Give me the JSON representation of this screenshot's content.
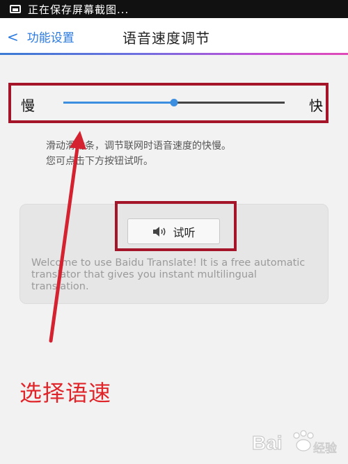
{
  "status_bar": {
    "text": "正在保存屏幕截图...",
    "icon": "screenshot-icon"
  },
  "header": {
    "back_label": "功能设置",
    "back_icon": "chevron-left-icon",
    "title": "语音速度调节",
    "gradient_colors": [
      "#3a7bd5",
      "#c24fd6",
      "#e04ab7"
    ]
  },
  "slider": {
    "slow_label": "慢",
    "fast_label": "快",
    "value_fraction": 0.5,
    "fill_color": "#3b8ee0",
    "track_color": "#444444"
  },
  "description": {
    "line1": "滑动滑动条，调节联网时语音速度的快慢。",
    "line2": "您可点击下方按钮试听。"
  },
  "sample": {
    "button_label": "试听",
    "button_icon": "speaker-icon",
    "text": "Welcome to use Baidu Translate! It is a free automatic translator that gives you instant multilingual translation."
  },
  "annotation": {
    "text": "选择语速",
    "color": "#e0252a",
    "highlight_color": "#a4152a"
  },
  "watermark": {
    "text": "Bai 经验",
    "icon": "baidu-paw-icon"
  }
}
